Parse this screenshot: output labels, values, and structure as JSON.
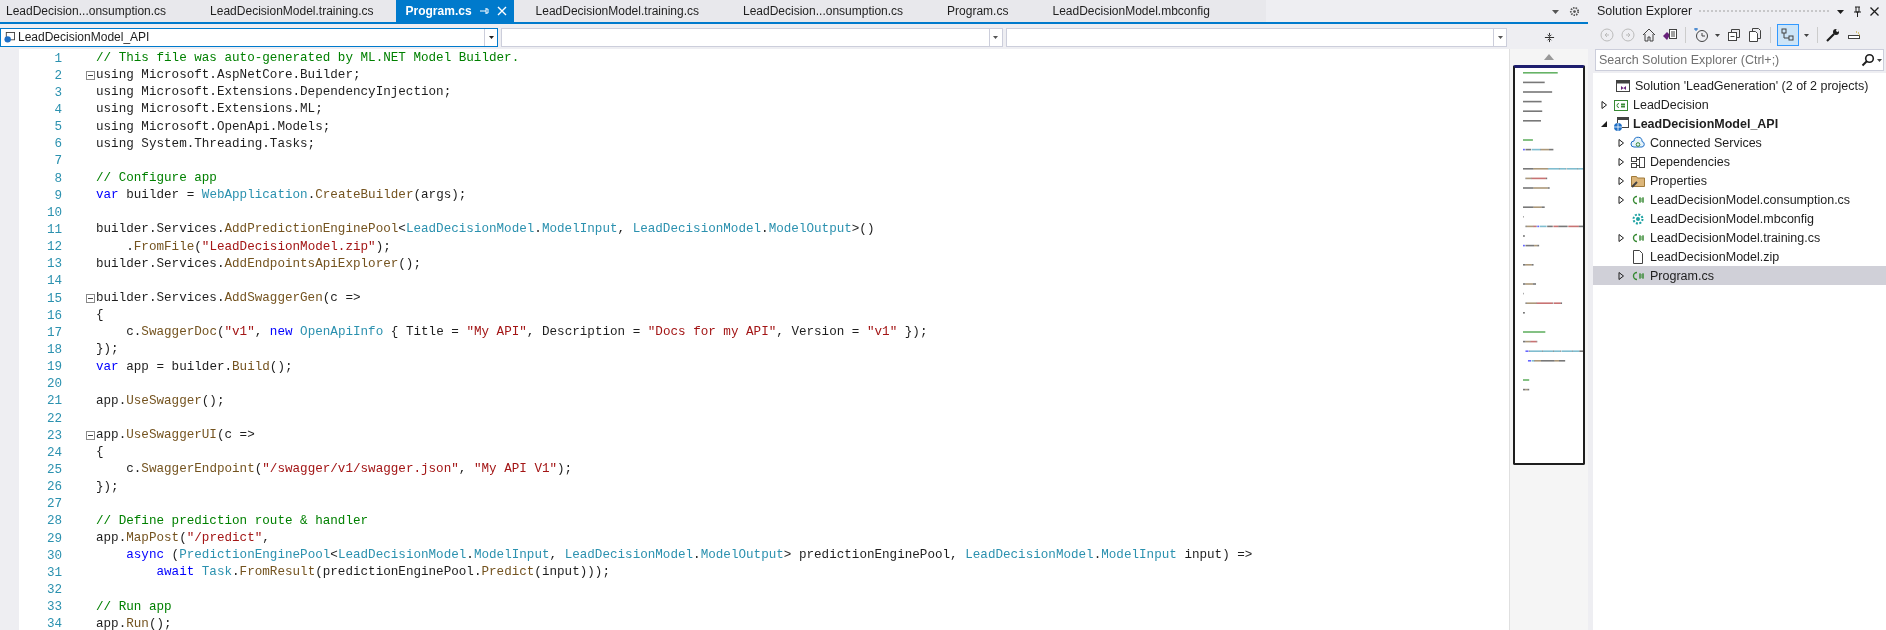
{
  "tabs": [
    {
      "label": "LeadDecision...onsumption.cs",
      "selected": false
    },
    {
      "label": "LeadDecisionModel.training.cs",
      "selected": false
    },
    {
      "label": "Program.cs",
      "selected": true
    },
    {
      "label": "LeadDecisionModel.training.cs",
      "selected": false
    },
    {
      "label": "LeadDecision...onsumption.cs",
      "selected": false
    },
    {
      "label": "Program.cs",
      "selected": false
    },
    {
      "label": "LeadDecisionModel.mbconfig",
      "selected": false
    }
  ],
  "navigation_bar": {
    "project": "LeadDecisionModel_API"
  },
  "code_lines": [
    {
      "number": "1",
      "foldable": false,
      "tokens": [
        {
          "kind": "comment",
          "text": "// This file was auto-generated by ML.NET Model Builder."
        }
      ]
    },
    {
      "number": "2",
      "foldable": true,
      "tokens": [
        {
          "kind": "plain",
          "text": "using Microsoft.AspNetCore.Builder;"
        }
      ]
    },
    {
      "number": "3",
      "foldable": false,
      "tokens": [
        {
          "kind": "plain",
          "text": "using Microsoft.Extensions.DependencyInjection;"
        }
      ]
    },
    {
      "number": "4",
      "foldable": false,
      "tokens": [
        {
          "kind": "plain",
          "text": "using Microsoft.Extensions.ML;"
        }
      ]
    },
    {
      "number": "5",
      "foldable": false,
      "tokens": [
        {
          "kind": "plain",
          "text": "using Microsoft.OpenApi.Models;"
        }
      ]
    },
    {
      "number": "6",
      "foldable": false,
      "tokens": [
        {
          "kind": "plain",
          "text": "using System.Threading.Tasks;"
        }
      ]
    },
    {
      "number": "7",
      "foldable": false
    },
    {
      "number": "8",
      "foldable": false,
      "tokens": [
        {
          "kind": "comment",
          "text": "// Configure app"
        }
      ]
    },
    {
      "number": "9",
      "foldable": false,
      "tokens": [
        {
          "kind": "keyword",
          "text": "var"
        },
        {
          "kind": "plain",
          "text": " builder = "
        },
        {
          "kind": "type",
          "text": "WebApplication"
        },
        {
          "kind": "plain",
          "text": "."
        },
        {
          "kind": "method",
          "text": "CreateBuilder"
        },
        {
          "kind": "plain",
          "text": "(args);"
        }
      ]
    },
    {
      "number": "10",
      "foldable": false
    },
    {
      "number": "11",
      "foldable": false,
      "tokens": [
        {
          "kind": "plain",
          "text": "builder.Services."
        },
        {
          "kind": "method",
          "text": "AddPredictionEnginePool"
        },
        {
          "kind": "plain",
          "text": "<"
        },
        {
          "kind": "type",
          "text": "LeadDecisionModel"
        },
        {
          "kind": "plain",
          "text": "."
        },
        {
          "kind": "type",
          "text": "ModelInput"
        },
        {
          "kind": "plain",
          "text": ", "
        },
        {
          "kind": "type",
          "text": "LeadDecisionModel"
        },
        {
          "kind": "plain",
          "text": "."
        },
        {
          "kind": "type",
          "text": "ModelOutput"
        },
        {
          "kind": "plain",
          "text": ">()"
        }
      ]
    },
    {
      "number": "12",
      "foldable": false,
      "tokens": [
        {
          "kind": "plain",
          "text": "    ."
        },
        {
          "kind": "method",
          "text": "FromFile"
        },
        {
          "kind": "plain",
          "text": "("
        },
        {
          "kind": "string",
          "text": "\"LeadDecisionModel.zip\""
        },
        {
          "kind": "plain",
          "text": ");"
        }
      ]
    },
    {
      "number": "13",
      "foldable": false,
      "tokens": [
        {
          "kind": "plain",
          "text": "builder.Services."
        },
        {
          "kind": "method",
          "text": "AddEndpointsApiExplorer"
        },
        {
          "kind": "plain",
          "text": "();"
        }
      ]
    },
    {
      "number": "14",
      "foldable": false
    },
    {
      "number": "15",
      "foldable": true,
      "tokens": [
        {
          "kind": "plain",
          "text": "builder.Services."
        },
        {
          "kind": "method",
          "text": "AddSwaggerGen"
        },
        {
          "kind": "plain",
          "text": "(c =>"
        }
      ]
    },
    {
      "number": "16",
      "foldable": false,
      "tokens": [
        {
          "kind": "plain",
          "text": "{"
        }
      ]
    },
    {
      "number": "17",
      "foldable": false,
      "tokens": [
        {
          "kind": "plain",
          "text": "    c."
        },
        {
          "kind": "method",
          "text": "SwaggerDoc"
        },
        {
          "kind": "plain",
          "text": "("
        },
        {
          "kind": "string",
          "text": "\"v1\""
        },
        {
          "kind": "plain",
          "text": ", "
        },
        {
          "kind": "keyword",
          "text": "new"
        },
        {
          "kind": "type",
          "text": " OpenApiInfo"
        },
        {
          "kind": "plain",
          "text": " { Title = "
        },
        {
          "kind": "string",
          "text": "\"My API\""
        },
        {
          "kind": "plain",
          "text": ", Description = "
        },
        {
          "kind": "string",
          "text": "\"Docs for my API\""
        },
        {
          "kind": "plain",
          "text": ", Version = "
        },
        {
          "kind": "string",
          "text": "\"v1\""
        },
        {
          "kind": "plain",
          "text": " });"
        }
      ]
    },
    {
      "number": "18",
      "foldable": false,
      "tokens": [
        {
          "kind": "plain",
          "text": "});"
        }
      ]
    },
    {
      "number": "19",
      "foldable": false,
      "tokens": [
        {
          "kind": "keyword",
          "text": "var"
        },
        {
          "kind": "plain",
          "text": " app = builder."
        },
        {
          "kind": "method",
          "text": "Build"
        },
        {
          "kind": "plain",
          "text": "();"
        }
      ]
    },
    {
      "number": "20",
      "foldable": false
    },
    {
      "number": "21",
      "foldable": false,
      "tokens": [
        {
          "kind": "plain",
          "text": "app."
        },
        {
          "kind": "method",
          "text": "UseSwagger"
        },
        {
          "kind": "plain",
          "text": "();"
        }
      ]
    },
    {
      "number": "22",
      "foldable": false
    },
    {
      "number": "23",
      "foldable": true,
      "tokens": [
        {
          "kind": "plain",
          "text": "app."
        },
        {
          "kind": "method",
          "text": "UseSwaggerUI"
        },
        {
          "kind": "plain",
          "text": "(c =>"
        }
      ]
    },
    {
      "number": "24",
      "foldable": false,
      "tokens": [
        {
          "kind": "plain",
          "text": "{"
        }
      ]
    },
    {
      "number": "25",
      "foldable": false,
      "tokens": [
        {
          "kind": "plain",
          "text": "    c."
        },
        {
          "kind": "method",
          "text": "SwaggerEndpoint"
        },
        {
          "kind": "plain",
          "text": "("
        },
        {
          "kind": "string",
          "text": "\"/swagger/v1/swagger.json\""
        },
        {
          "kind": "plain",
          "text": ", "
        },
        {
          "kind": "string",
          "text": "\"My API V1\""
        },
        {
          "kind": "plain",
          "text": ");"
        }
      ]
    },
    {
      "number": "26",
      "foldable": false,
      "tokens": [
        {
          "kind": "plain",
          "text": "});"
        }
      ]
    },
    {
      "number": "27",
      "foldable": false
    },
    {
      "number": "28",
      "foldable": false,
      "tokens": [
        {
          "kind": "comment",
          "text": "// Define prediction route & handler"
        }
      ]
    },
    {
      "number": "29",
      "foldable": false,
      "tokens": [
        {
          "kind": "plain",
          "text": "app."
        },
        {
          "kind": "method",
          "text": "MapPost"
        },
        {
          "kind": "plain",
          "text": "("
        },
        {
          "kind": "string",
          "text": "\"/predict\""
        },
        {
          "kind": "plain",
          "text": ","
        }
      ]
    },
    {
      "number": "30",
      "foldable": false,
      "tokens": [
        {
          "kind": "keyword",
          "text": "    async"
        },
        {
          "kind": "plain",
          "text": " ("
        },
        {
          "kind": "type",
          "text": "PredictionEnginePool"
        },
        {
          "kind": "plain",
          "text": "<"
        },
        {
          "kind": "type",
          "text": "LeadDecisionModel"
        },
        {
          "kind": "plain",
          "text": "."
        },
        {
          "kind": "type",
          "text": "ModelInput"
        },
        {
          "kind": "plain",
          "text": ", "
        },
        {
          "kind": "type",
          "text": "LeadDecisionModel"
        },
        {
          "kind": "plain",
          "text": "."
        },
        {
          "kind": "type",
          "text": "ModelOutput"
        },
        {
          "kind": "plain",
          "text": "> predictionEnginePool, "
        },
        {
          "kind": "type",
          "text": "LeadDecisionModel"
        },
        {
          "kind": "plain",
          "text": "."
        },
        {
          "kind": "type",
          "text": "ModelInput"
        },
        {
          "kind": "plain",
          "text": " input) =>"
        }
      ]
    },
    {
      "number": "31",
      "foldable": false,
      "tokens": [
        {
          "kind": "keyword",
          "text": "        await"
        },
        {
          "kind": "type",
          "text": " Task"
        },
        {
          "kind": "plain",
          "text": "."
        },
        {
          "kind": "method",
          "text": "FromResult"
        },
        {
          "kind": "plain",
          "text": "(predictionEnginePool."
        },
        {
          "kind": "method",
          "text": "Predict"
        },
        {
          "kind": "plain",
          "text": "(input)));"
        }
      ]
    },
    {
      "number": "32",
      "foldable": false
    },
    {
      "number": "33",
      "foldable": false,
      "tokens": [
        {
          "kind": "comment",
          "text": "// Run app"
        }
      ]
    },
    {
      "number": "34",
      "foldable": false,
      "tokens": [
        {
          "kind": "plain",
          "text": "app."
        },
        {
          "kind": "method",
          "text": "Run"
        },
        {
          "kind": "plain",
          "text": "();"
        }
      ]
    }
  ],
  "solution_explorer": {
    "title": "Solution Explorer",
    "search": {
      "placeholder": "Search Solution Explorer (Ctrl+;)"
    },
    "tree": [
      {
        "label": "Solution 'LeadGeneration' (2 of 2 projects)",
        "kind": "solution",
        "expandable": false,
        "startup": false,
        "selected": false,
        "children": [
          {
            "label": "LeadDecision",
            "kind": "csproject",
            "expandable": true,
            "expanded": false,
            "startup": false,
            "selected": false
          },
          {
            "label": "LeadDecisionModel_API",
            "kind": "webproject",
            "expandable": true,
            "expanded": true,
            "startup": true,
            "selected": false,
            "children": [
              {
                "label": "Connected Services",
                "kind": "connected",
                "expandable": true,
                "expanded": false,
                "startup": false,
                "selected": false
              },
              {
                "label": "Dependencies",
                "kind": "dependencies",
                "expandable": true,
                "expanded": false,
                "startup": false,
                "selected": false
              },
              {
                "label": "Properties",
                "kind": "properties",
                "expandable": true,
                "expanded": false,
                "startup": false,
                "selected": false
              },
              {
                "label": "LeadDecisionModel.consumption.cs",
                "kind": "csharp",
                "expandable": true,
                "expanded": false,
                "startup": false,
                "selected": false
              },
              {
                "label": "LeadDecisionModel.mbconfig",
                "kind": "mbconfig",
                "expandable": false,
                "startup": false,
                "selected": false
              },
              {
                "label": "LeadDecisionModel.training.cs",
                "kind": "csharp",
                "expandable": true,
                "expanded": false,
                "startup": false,
                "selected": false
              },
              {
                "label": "LeadDecisionModel.zip",
                "kind": "file",
                "expandable": false,
                "startup": false,
                "selected": false
              },
              {
                "label": "Program.cs",
                "kind": "csharp",
                "expandable": true,
                "expanded": false,
                "startup": false,
                "selected": true
              }
            ]
          }
        ]
      }
    ]
  }
}
